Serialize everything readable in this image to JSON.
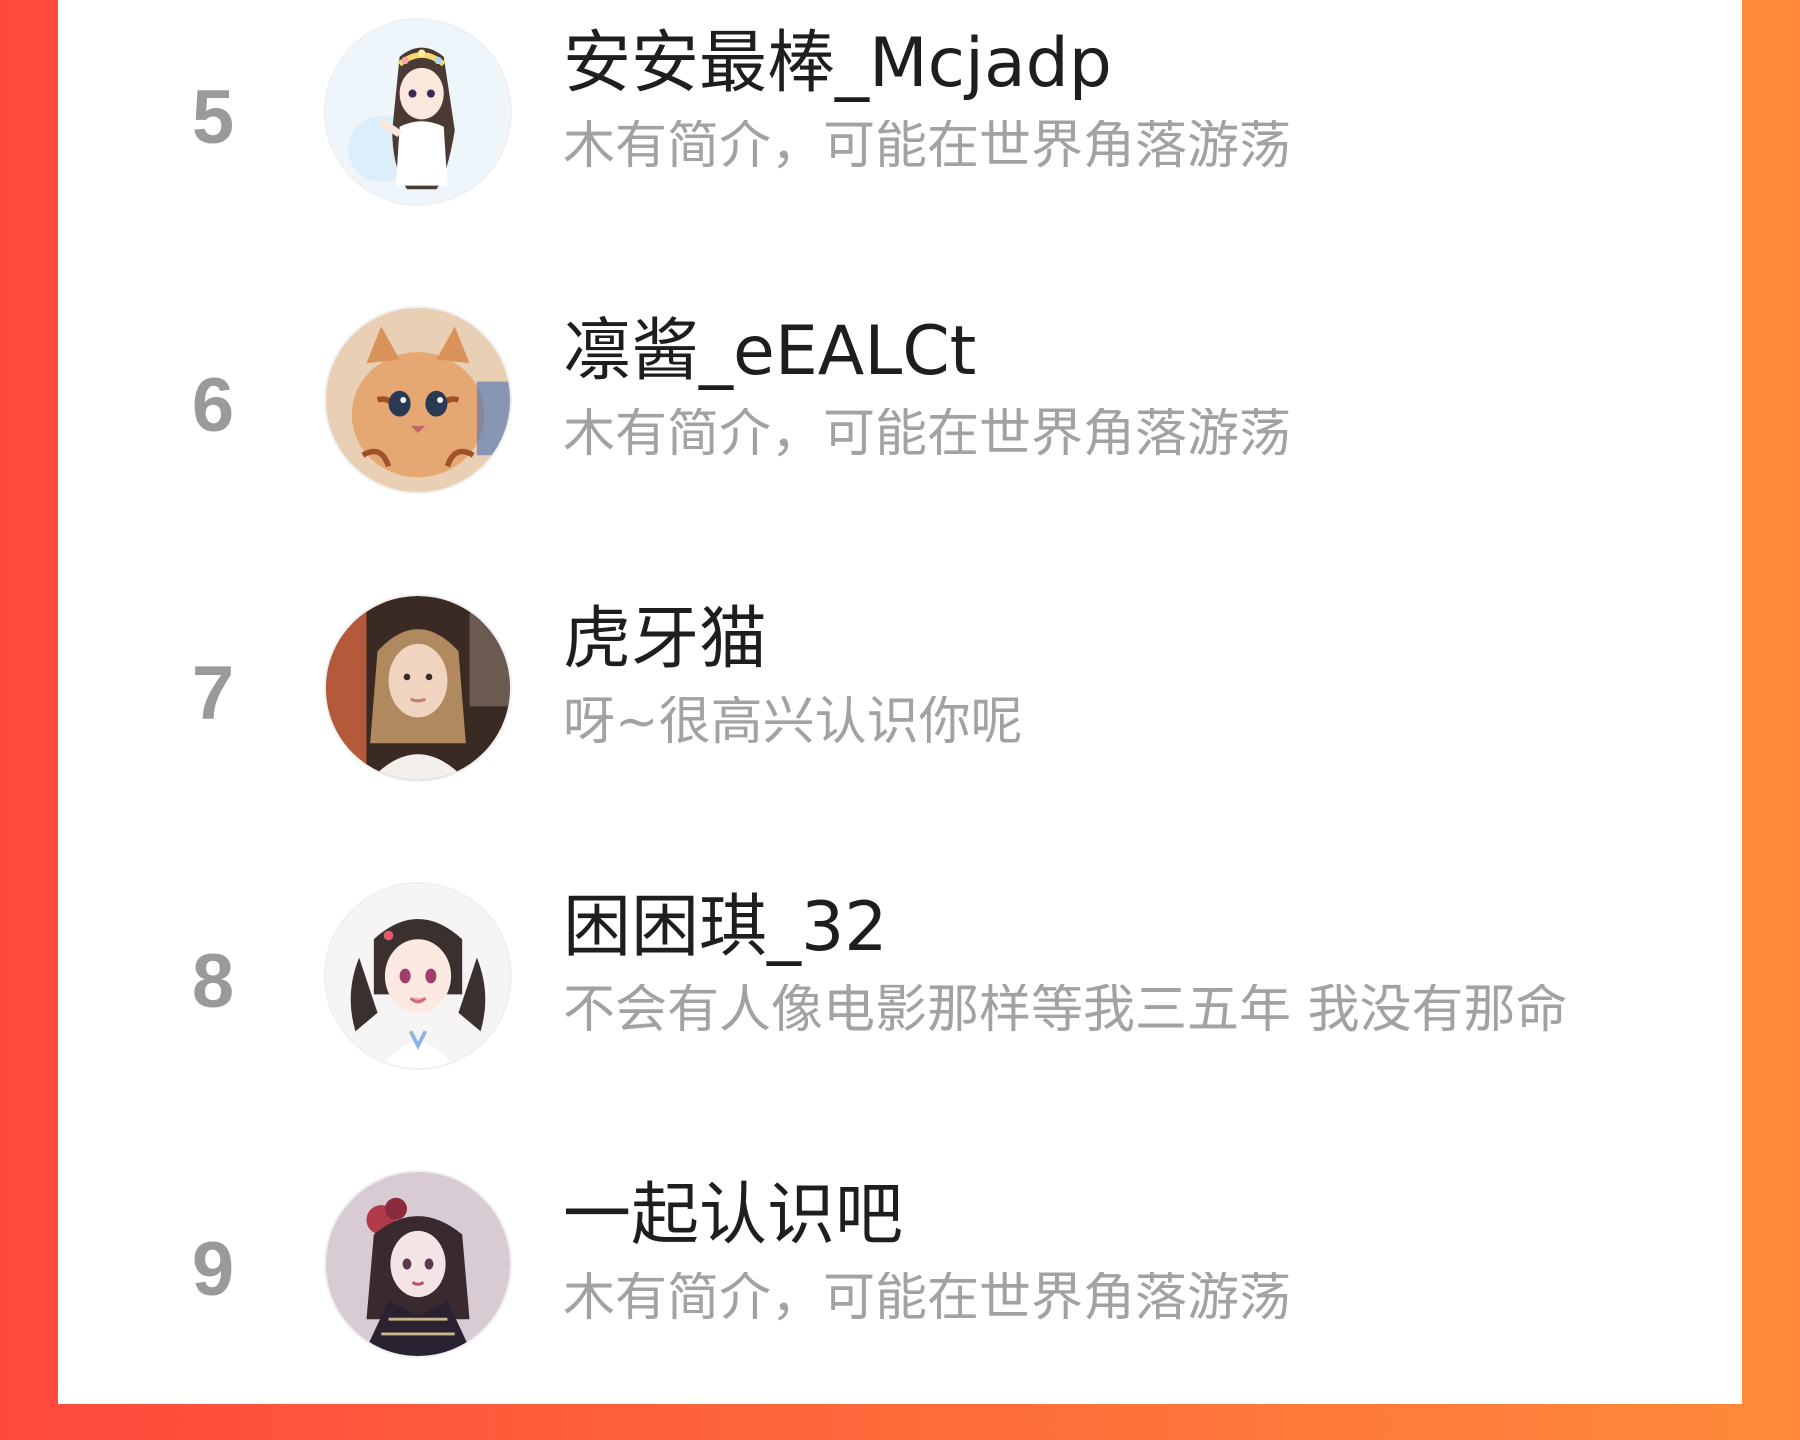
{
  "colors": {
    "frame_left": "#ff4a3d",
    "frame_right": "#ff8a3a",
    "panel": "#ffffff",
    "name_text": "#1e1e1e",
    "bio_text": "#a2a2a2",
    "rank_text": "#9a9a9a"
  },
  "list": {
    "items": [
      {
        "rank": "5",
        "name": "安安最棒_Mcjadp",
        "bio": "木有简介，可能在世界角落游荡",
        "avatar_icon": "anime-girl-flower-crown-avatar"
      },
      {
        "rank": "6",
        "name": "凛酱_eEALCt",
        "bio": "木有简介，可能在世界角落游荡",
        "avatar_icon": "tiger-cat-avatar"
      },
      {
        "rank": "7",
        "name": "虎牙猫",
        "bio": "呀~很高兴认识你呢",
        "avatar_icon": "photo-woman-avatar"
      },
      {
        "rank": "8",
        "name": "困困琪_32",
        "bio": "不会有人像电影那样等我三五年 我没有那命",
        "avatar_icon": "anime-girl-twin-tails-avatar"
      },
      {
        "rank": "9",
        "name": "一起认识吧",
        "bio": "木有简介，可能在世界角落游荡",
        "avatar_icon": "gothic-girl-avatar"
      }
    ]
  }
}
